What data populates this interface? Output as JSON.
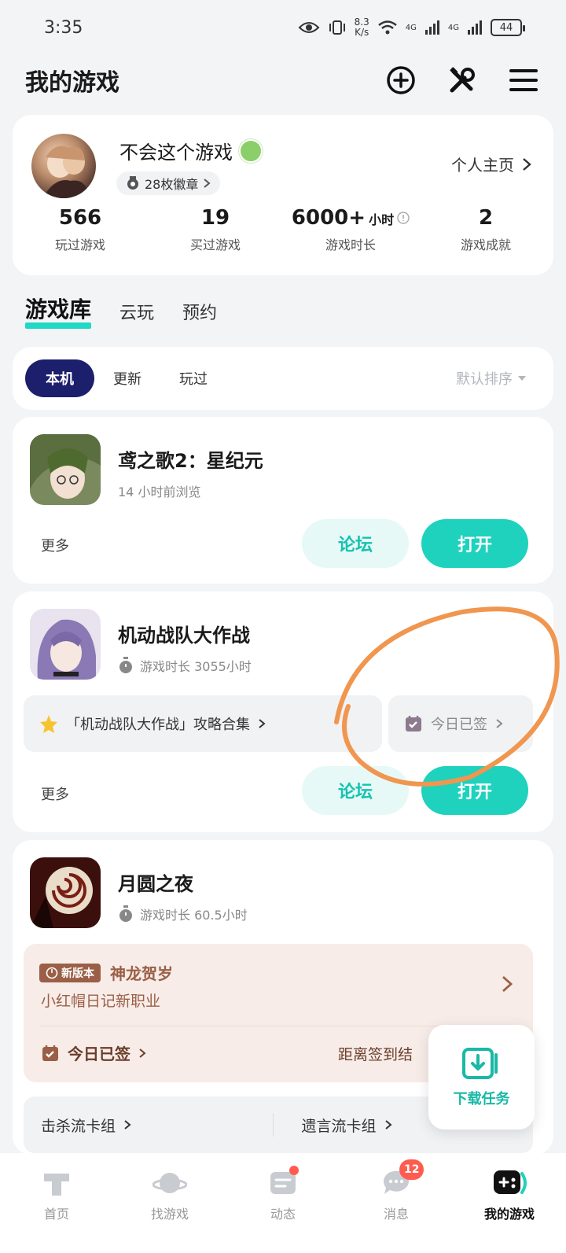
{
  "status_bar": {
    "time": "3:35",
    "net_speed_top": "8.3",
    "net_speed_bottom": "K/s",
    "sig1": "4G",
    "sig2": "4G",
    "battery": "44"
  },
  "header": {
    "title": "我的游戏"
  },
  "profile": {
    "username": "不会这个游戏",
    "badges": "28枚徽章",
    "homepage_label": "个人主页",
    "stats": [
      {
        "value": "566",
        "unit": "",
        "label": "玩过游戏"
      },
      {
        "value": "19",
        "unit": "",
        "label": "买过游戏"
      },
      {
        "value": "6000+",
        "unit": "小时",
        "label": "游戏时长"
      },
      {
        "value": "2",
        "unit": "",
        "label": "游戏成就"
      }
    ]
  },
  "tabs": [
    "游戏库",
    "云玩",
    "预约"
  ],
  "filter": {
    "chips": [
      "本机",
      "更新",
      "玩过"
    ],
    "sort": "默认排序"
  },
  "games": [
    {
      "name": "鸢之歌2：星纪元",
      "sub": "14 小时前浏览",
      "more": "更多",
      "forum": "论坛",
      "open": "打开"
    },
    {
      "name": "机动战队大作战",
      "sub": "游戏时长 3055小时",
      "guide": "「机动战队大作战」攻略合集",
      "checkin": "今日已签",
      "more": "更多",
      "forum": "论坛",
      "open": "打开"
    },
    {
      "name": "月圆之夜",
      "sub": "游戏时长 60.5小时",
      "promo_tag": "新版本",
      "promo_title": "神龙贺岁",
      "promo_desc": "小红帽日记新职业",
      "checkin": "今日已签",
      "checkin_right": "距离签到结",
      "deck_left": "击杀流卡组",
      "deck_right": "遗言流卡组"
    }
  ],
  "download": {
    "label": "下载任务"
  },
  "bottom_nav": [
    {
      "label": "首页"
    },
    {
      "label": "找游戏"
    },
    {
      "label": "动态"
    },
    {
      "label": "消息",
      "badge": "12"
    },
    {
      "label": "我的游戏"
    }
  ],
  "colors": {
    "accent": "#1fd2bd",
    "chip_active": "#1c1f6b",
    "annotation": "#f0964f"
  }
}
